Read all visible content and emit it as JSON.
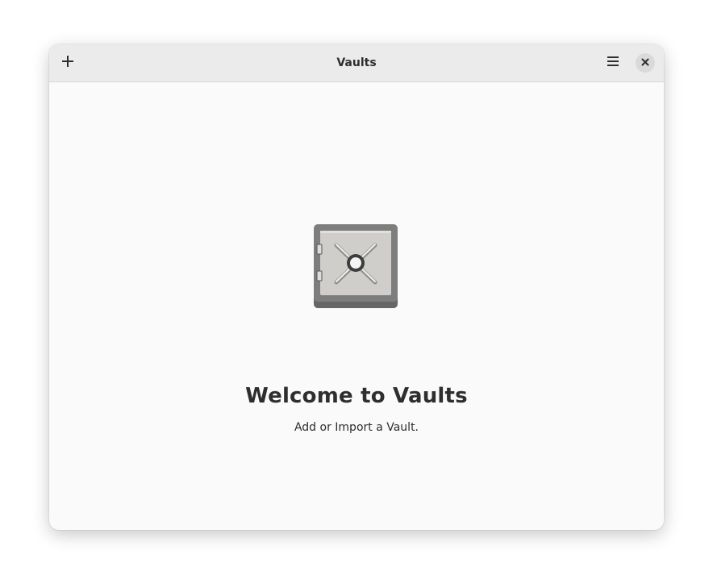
{
  "window": {
    "title": "Vaults"
  },
  "headerbar": {
    "add_icon": "plus-icon",
    "menu_icon": "hamburger-menu-icon",
    "close_icon": "close-icon"
  },
  "empty_state": {
    "icon": "safe-vault-icon",
    "title": "Welcome to Vaults",
    "description": "Add or Import a Vault."
  },
  "colors": {
    "headerbar_bg": "#ebebeb",
    "window_bg": "#fafafa",
    "text": "#2e2e2e",
    "safe_body": "#7b7b7b",
    "safe_door": "#cfcdca"
  }
}
